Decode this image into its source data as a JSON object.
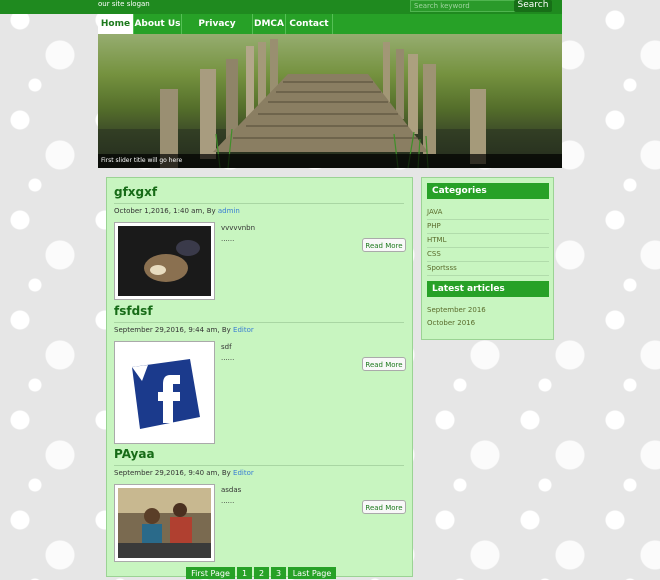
{
  "header": {
    "slogan": "our site slogan",
    "search_placeholder": "Search keyword",
    "search_button": "Search"
  },
  "nav": {
    "items": [
      {
        "label": "Home",
        "active": true
      },
      {
        "label": "About Us"
      },
      {
        "label": "Privacy Policy"
      },
      {
        "label": "DMCA"
      },
      {
        "label": "Contact"
      }
    ]
  },
  "slider": {
    "caption": "First slider title will go here"
  },
  "posts": [
    {
      "title": "gfxgxf",
      "date": "October 1,2016, 1:40 am,",
      "by": "By",
      "author": "admin",
      "excerpt": "vvvvvnbn",
      "ellipsis": "......",
      "read_more": "Read More"
    },
    {
      "title": "fsfdsf",
      "date": "September 29,2016, 9:44 am,",
      "by": "By",
      "author": "Editor",
      "excerpt": "sdf",
      "ellipsis": "......",
      "read_more": "Read More"
    },
    {
      "title": "PAyaa",
      "date": "September 29,2016, 9:40 am,",
      "by": "By",
      "author": "Editor",
      "excerpt": "asdas",
      "ellipsis": "......",
      "read_more": "Read More"
    }
  ],
  "pagination": {
    "first": "First Page",
    "pages": [
      "1",
      "2",
      "3"
    ],
    "last": "Last Page"
  },
  "sidebar": {
    "categories_title": "Categories",
    "categories": [
      "JAVA",
      "PHP",
      "HTML",
      "CSS",
      "Sportsss"
    ],
    "latest_title": "Latest articles",
    "latest": [
      "September 2016",
      "October 2016"
    ]
  },
  "colors": {
    "brand_green": "#27a127",
    "panel_bg": "#c8f5c0",
    "author_link": "#3a7ed3"
  }
}
